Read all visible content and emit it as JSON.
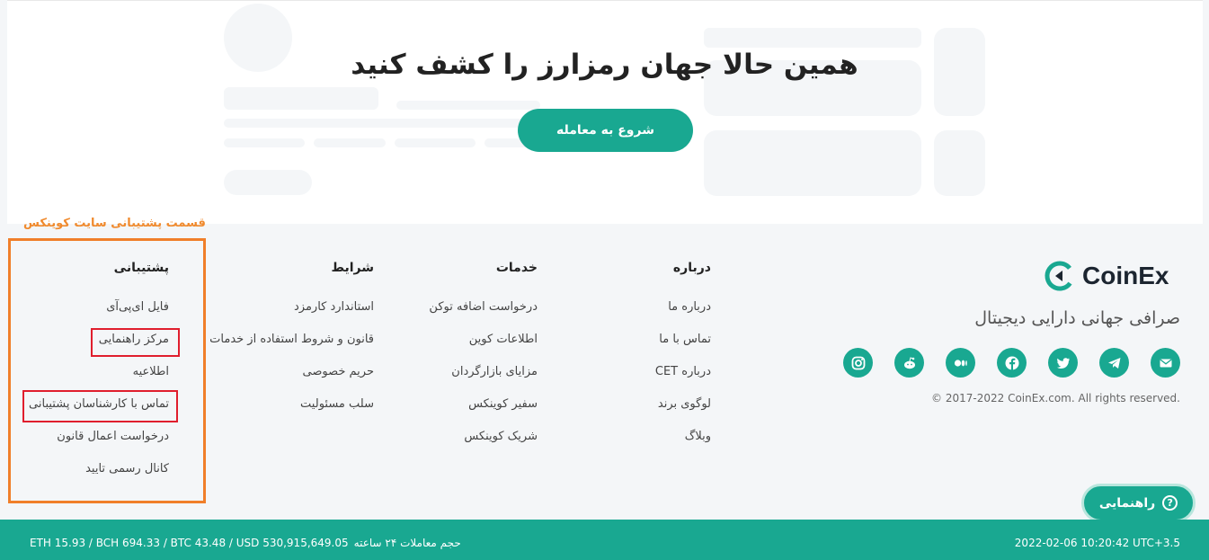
{
  "cta": {
    "title": "همین حالا جهان رمزارز را کشف کنید",
    "button": "شروع به معامله"
  },
  "annotation": {
    "label": "قسمت پشتیبانی سایت کوینکس"
  },
  "footer": {
    "columns": {
      "about": {
        "title": "درباره",
        "items": [
          "درباره ما",
          "تماس با ما",
          "درباره CET",
          "لوگوی برند",
          "وبلاگ"
        ]
      },
      "services": {
        "title": "خدمات",
        "items": [
          "درخواست اضافه توکن",
          "اطلاعات کوین",
          "مزایای بازارگردان",
          "سفیر کوینکس",
          "شریک کوینکس"
        ]
      },
      "terms": {
        "title": "شرایط",
        "items": [
          "استاندارد کارمزد",
          "قانون و شروط استفاده از خدمات",
          "حریم خصوصی",
          "سلب مسئولیت"
        ]
      },
      "support": {
        "title": "پشتیبانی",
        "items": [
          "فایل ای‌پی‌آی",
          "مرکز راهنمایی",
          "اطلاعیه",
          "تماس با کارشناسان پشتیبانی",
          "درخواست اعمال قانون",
          "کانال رسمی تایید"
        ]
      }
    },
    "brand": {
      "name": "CoinEx",
      "tagline": "صرافی جهانی دارایی دیجیتال",
      "copyright": "© 2017-2022 CoinEx.com. All rights reserved.",
      "social_icons": [
        "email-icon",
        "telegram-icon",
        "twitter-icon",
        "facebook-icon",
        "medium-icon",
        "reddit-icon",
        "instagram-icon"
      ]
    }
  },
  "help_button": {
    "label": "راهنمایی"
  },
  "bottom_bar": {
    "volume_label": "حجم معاملات ۲۴ ساعته",
    "volume_values": "ETH 15.93 / BCH 694.33 / BTC 43.48 / USD 530,915,649.05",
    "datetime": "2022-02-06 10:20:42 UTC+3.5"
  },
  "colors": {
    "accent": "#19a891",
    "annotation_orange": "#f07f2a",
    "highlight_red": "#e01e2d"
  }
}
